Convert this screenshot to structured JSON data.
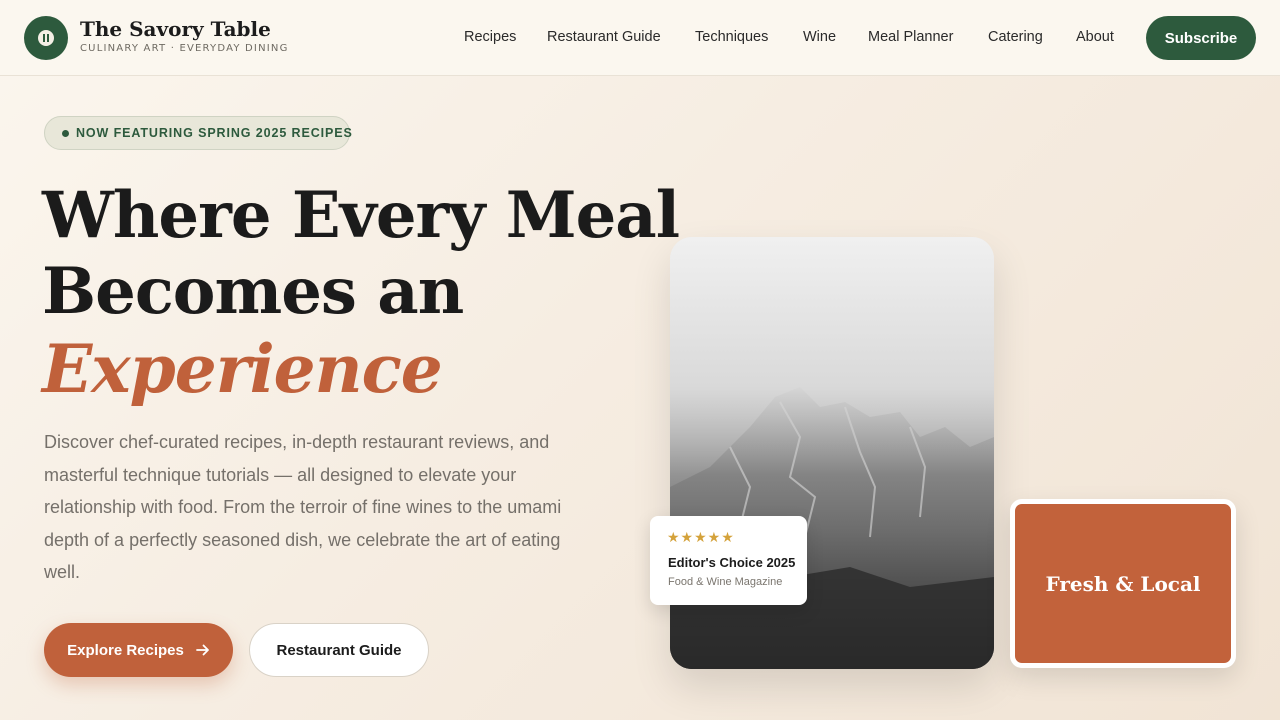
{
  "brand": {
    "name": "The Savory Table",
    "tagline": "CULINARY ART · EVERYDAY DINING",
    "logo_icon": "fork-knife-icon"
  },
  "nav": {
    "items": [
      {
        "label": "Recipes"
      },
      {
        "label": "Restaurant Guide"
      },
      {
        "label": "Techniques"
      },
      {
        "label": "Wine"
      },
      {
        "label": "Meal Planner"
      },
      {
        "label": "Catering"
      },
      {
        "label": "About"
      }
    ],
    "subscribe_label": "Subscribe"
  },
  "hero": {
    "badge": "NOW FEATURING SPRING 2025 RECIPES",
    "headline_line1": "Where Every Meal",
    "headline_line2": "Becomes an",
    "headline_accent": "Experience",
    "description": "Discover chef-curated recipes, in-depth restaurant reviews, and masterful technique tutorials — all designed to elevate your relationship with food. From the terroir of fine wines to the umami depth of a perfectly seasoned dish, we celebrate the art of eating well.",
    "primary_cta": "Explore Recipes",
    "primary_cta_icon": "arrow-right-icon",
    "secondary_cta": "Restaurant Guide"
  },
  "review_card": {
    "stars": "★★★★★",
    "rating": 5,
    "title": "Editor's Choice 2025",
    "source": "Food & Wine Magazine"
  },
  "feature_card": {
    "label": "Fresh & Local"
  },
  "colors": {
    "accent": "#c0613b",
    "brand_green": "#2d5a3d",
    "background": "#f6ede2"
  }
}
